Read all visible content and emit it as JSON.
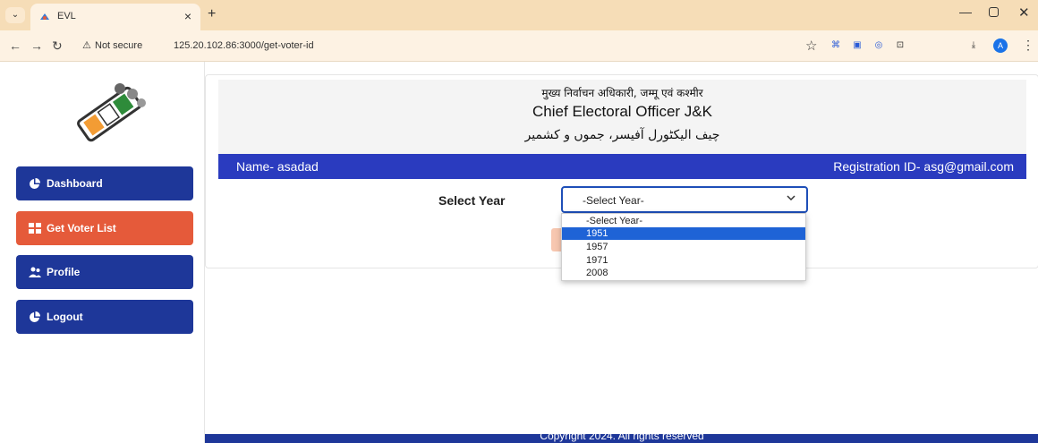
{
  "browser": {
    "tab_title": "EVL",
    "tab_close": "×",
    "new_tab": "+",
    "not_secure": "Not secure",
    "url": "125.20.102.86:3000/get-voter-id",
    "profile_initial": "A"
  },
  "header": {
    "hindi": "मुख्य निर्वाचन अधिकारी, जम्मू एवं कश्मीर",
    "english": "Chief Electoral Officer J&K",
    "urdu": "چیف الیکٹورل آفیسر، جموں و کشمیر"
  },
  "sidebar": {
    "items": [
      {
        "label": "Dashboard",
        "icon": "pie-chart-icon"
      },
      {
        "label": "Get Voter List",
        "icon": "grid-icon"
      },
      {
        "label": "Profile",
        "icon": "users-icon"
      },
      {
        "label": "Logout",
        "icon": "pie-chart-icon"
      }
    ]
  },
  "user": {
    "name": "Name- asadad",
    "registration": "Registration ID- asg@gmail.com"
  },
  "form": {
    "year_label": "Select Year",
    "selected": "-Select Year-",
    "options": [
      "-Select Year-",
      "1951",
      "1957",
      "1971",
      "2008"
    ],
    "highlighted": "1951"
  },
  "footer": {
    "text": "Copyright 2024. All rights reserved"
  },
  "colors": {
    "primary": "#1e3799",
    "accent": "#e55a3a",
    "info_bar": "#2a3bbf",
    "tabbar": "#f6ddb7"
  }
}
